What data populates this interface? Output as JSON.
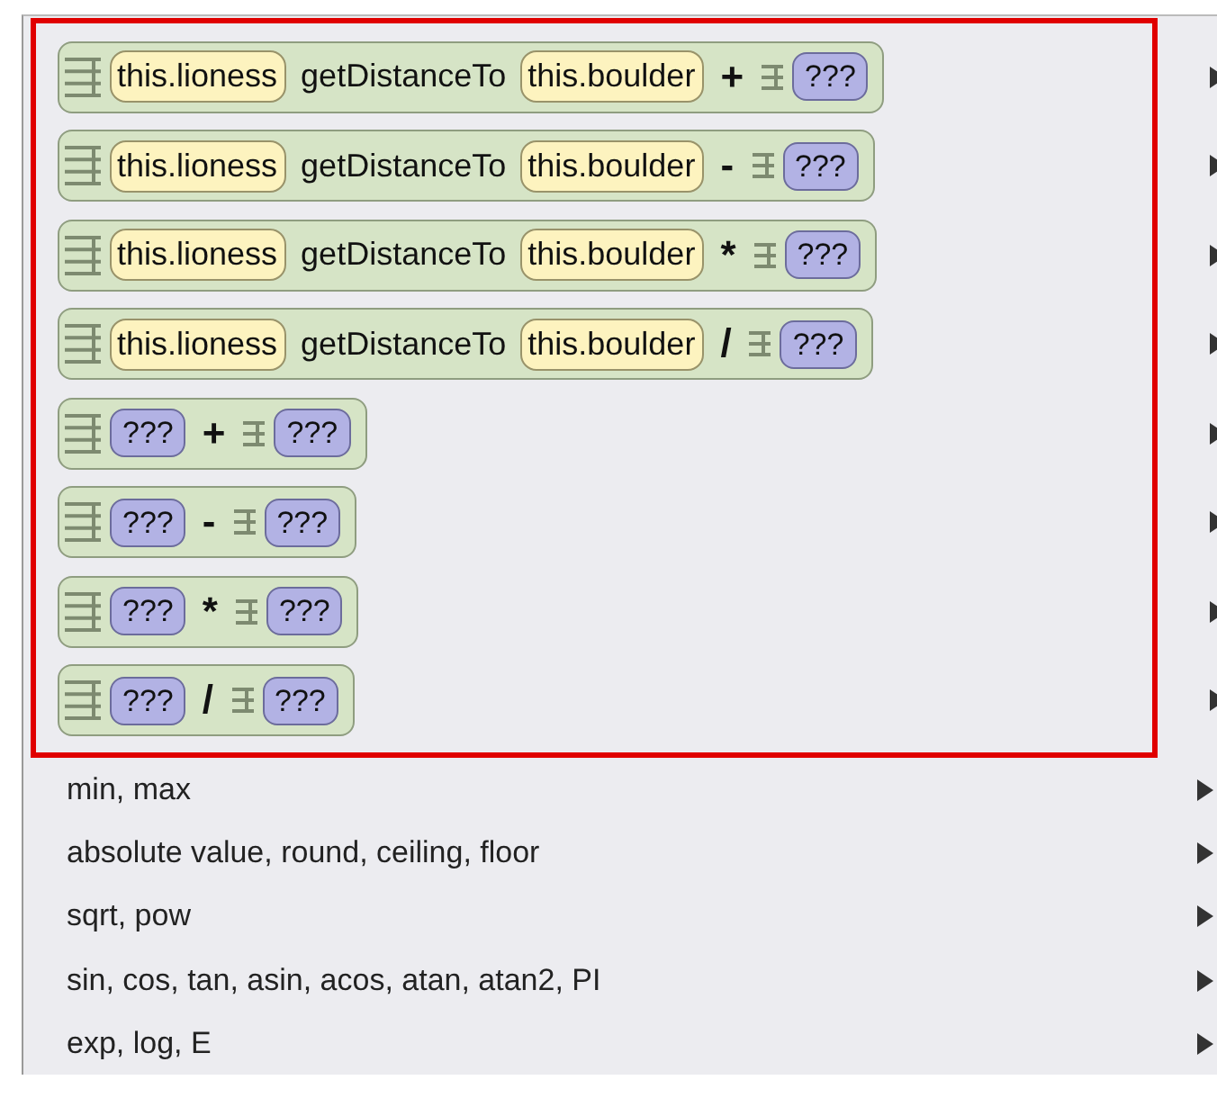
{
  "menu": {
    "highlighted_section": true,
    "blocks": [
      {
        "kind": "method-call",
        "object": "this.lioness",
        "method": "getDistanceTo",
        "argument": "this.boulder",
        "operator": "+",
        "right": "???"
      },
      {
        "kind": "method-call",
        "object": "this.lioness",
        "method": "getDistanceTo",
        "argument": "this.boulder",
        "operator": "-",
        "right": "???"
      },
      {
        "kind": "method-call",
        "object": "this.lioness",
        "method": "getDistanceTo",
        "argument": "this.boulder",
        "operator": "*",
        "right": "???"
      },
      {
        "kind": "method-call",
        "object": "this.lioness",
        "method": "getDistanceTo",
        "argument": "this.boulder",
        "operator": "/",
        "right": "???"
      },
      {
        "kind": "placeholder",
        "left": "???",
        "operator": "+",
        "right": "???"
      },
      {
        "kind": "placeholder",
        "left": "???",
        "operator": "-",
        "right": "???"
      },
      {
        "kind": "placeholder",
        "left": "???",
        "operator": "*",
        "right": "???"
      },
      {
        "kind": "placeholder",
        "left": "???",
        "operator": "/",
        "right": "???"
      }
    ],
    "items": [
      {
        "label": "min, max"
      },
      {
        "label": "absolute value, round, ceiling, floor"
      },
      {
        "label": "sqrt, pow"
      },
      {
        "label": "sin, cos, tan, asin, acos, atan, atan2, PI"
      },
      {
        "label": "exp, log, E"
      }
    ]
  }
}
